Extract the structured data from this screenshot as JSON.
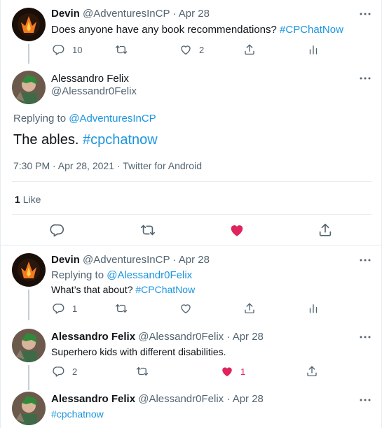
{
  "colors": {
    "link": "#1b95e0",
    "like": "#e0245e",
    "muted": "#536471",
    "divider": "#e6ecf0"
  },
  "tweet1": {
    "name": "Devin",
    "handle": "@AdventuresInCP",
    "sep": "·",
    "date": "Apr 28",
    "text": "Does anyone have any book recommendations?",
    "hashtag": "#CPChatNow",
    "replies": "10",
    "likes": "2"
  },
  "main": {
    "name": "Alessandro Felix",
    "handle": "@Alessandr0Felix",
    "replying_to_label": "Replying to",
    "replying_to_handle": "@AdventuresInCP",
    "text": "The ables.",
    "hashtag": "#cpchatnow",
    "timestamp": "7:30 PM · Apr 28, 2021 · Twitter for Android",
    "like_count": "1",
    "like_label": "Like"
  },
  "reply1": {
    "name": "Devin",
    "handle": "@AdventuresInCP",
    "sep": "·",
    "date": "Apr 28",
    "replying_to_label": "Replying to",
    "replying_to_handle": "@Alessandr0Felix",
    "text": "What’s that about?",
    "hashtag": "#CPChatNow",
    "replies": "1"
  },
  "reply2": {
    "name": "Alessandro Felix",
    "handle": "@Alessandr0Felix",
    "sep": "·",
    "date": "Apr 28",
    "text": "Superhero kids with different disabilities.",
    "replies": "2",
    "likes": "1"
  },
  "reply3": {
    "name": "Alessandro Felix",
    "handle": "@Alessandr0Felix",
    "sep": "·",
    "date": "Apr 28",
    "hashtag": "#cpchatnow"
  }
}
